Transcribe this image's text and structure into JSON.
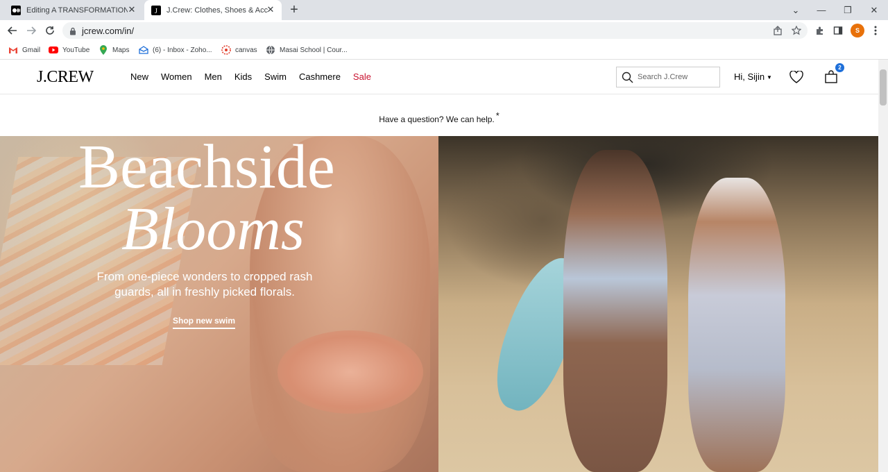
{
  "browser": {
    "tabs": [
      {
        "title": "Editing A TRANSFORMATION INT",
        "favicon": "medium-icon"
      },
      {
        "title": "J.Crew: Clothes, Shoes & Accesso",
        "favicon": "jcrew-icon"
      }
    ],
    "url": "jcrew.com/in/",
    "profile_initial": "S",
    "bookmarks": [
      {
        "label": "Gmail",
        "icon": "gmail-icon"
      },
      {
        "label": "YouTube",
        "icon": "youtube-icon"
      },
      {
        "label": "Maps",
        "icon": "maps-icon"
      },
      {
        "label": "(6) - Inbox - Zoho...",
        "icon": "zoho-icon"
      },
      {
        "label": "canvas",
        "icon": "canvas-icon"
      },
      {
        "label": "Masai School | Cour...",
        "icon": "globe-icon"
      }
    ]
  },
  "site": {
    "logo": "J.CREW",
    "nav": [
      "New",
      "Women",
      "Men",
      "Kids",
      "Swim",
      "Cashmere",
      "Sale"
    ],
    "search_placeholder": "Search J.Crew",
    "greeting": "Hi, Sijin",
    "bag_count": "2",
    "promo": "Have a question? We can help.",
    "promo_asterisk": "*"
  },
  "hero": {
    "headline_line1": "Beachside",
    "headline_line2": "Blooms",
    "subtext": "From one-piece wonders to cropped rash guards, all in freshly picked florals.",
    "cta": "Shop new swim"
  },
  "colors": {
    "sale": "#c8102e",
    "bag_badge": "#1e6fd9",
    "profile": "#e8710a"
  }
}
